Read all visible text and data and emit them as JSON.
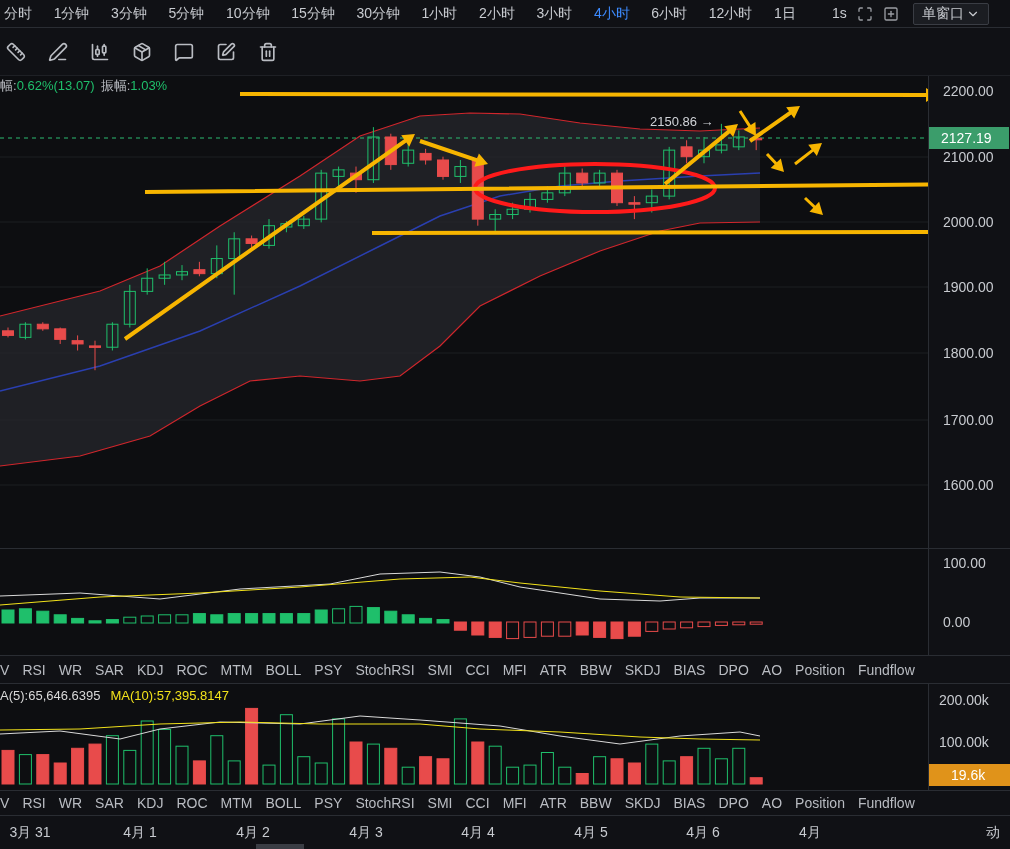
{
  "intervals": [
    {
      "label": "分时",
      "selected": false
    },
    {
      "label": "1分钟",
      "selected": false
    },
    {
      "label": "3分钟",
      "selected": false
    },
    {
      "label": "5分钟",
      "selected": false
    },
    {
      "label": "10分钟",
      "selected": false
    },
    {
      "label": "15分钟",
      "selected": false
    },
    {
      "label": "30分钟",
      "selected": false
    },
    {
      "label": "1小时",
      "selected": false
    },
    {
      "label": "2小时",
      "selected": false
    },
    {
      "label": "3小时",
      "selected": false
    },
    {
      "label": "4小时",
      "selected": true
    },
    {
      "label": "6小时",
      "selected": false
    },
    {
      "label": "12小时",
      "selected": false
    },
    {
      "label": "1日",
      "selected": false
    }
  ],
  "seconds_button": "1s",
  "window_mode": "单窗口",
  "stats": [
    {
      "label": "幅:",
      "value": "0.62%(13.07)"
    },
    {
      "label": "振幅:",
      "value": "1.03%"
    }
  ],
  "price_axis": [
    "2200.00",
    "2100.00",
    "2000.00",
    "1900.00",
    "1800.00",
    "1700.00",
    "1600.00"
  ],
  "high_marker": "2150.86 →",
  "current_price": "2127.19",
  "oscillator_axis": [
    "100.00",
    "0.00"
  ],
  "indicator_tabs": [
    "V",
    "RSI",
    "WR",
    "SAR",
    "KDJ",
    "ROC",
    "MTM",
    "BOLL",
    "PSY",
    "StochRSI",
    "SMI",
    "CCI",
    "MFI",
    "ATR",
    "BBW",
    "SKDJ",
    "BIAS",
    "DPO",
    "AO",
    "Position",
    "Fundflow"
  ],
  "volume_legend": [
    {
      "label": "A(5):65,646.6395",
      "color": "#d9d9d9"
    },
    {
      "label": "MA(10):57,395.8147",
      "color": "#f2e21b"
    }
  ],
  "volume_axis": [
    "200.00k",
    "100.00k"
  ],
  "current_volume": "19.6k",
  "volume_tabs": [
    "V",
    "RSI",
    "WR",
    "SAR",
    "KDJ",
    "ROC",
    "MTM",
    "BOLL",
    "PSY",
    "StochRSI",
    "SMI",
    "CCI",
    "MFI",
    "ATR",
    "BBW",
    "SKDJ",
    "BIAS",
    "DPO",
    "AO",
    "Position",
    "Fundflow"
  ],
  "date_axis": [
    "3月 31",
    "4月 1",
    "4月 2",
    "4月 3",
    "4月 4",
    "4月 5",
    "4月 6",
    "4月",
    "动"
  ]
}
